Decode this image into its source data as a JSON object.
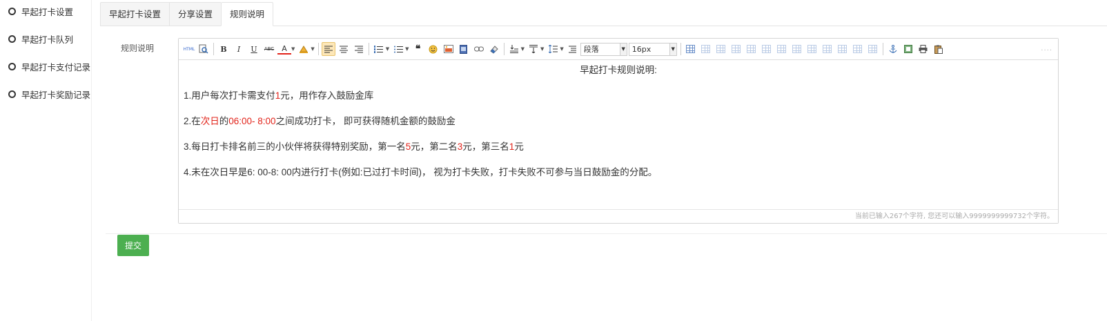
{
  "sidebar": {
    "items": [
      {
        "label": "早起打卡设置"
      },
      {
        "label": "早起打卡队列"
      },
      {
        "label": "早起打卡支付记录"
      },
      {
        "label": "早起打卡奖励记录"
      }
    ]
  },
  "tabs": [
    {
      "label": "早起打卡设置",
      "active": false
    },
    {
      "label": "分享设置",
      "active": false
    },
    {
      "label": "规则说明",
      "active": true
    }
  ],
  "form": {
    "field_label": "规则说明",
    "submit_label": "提交"
  },
  "editor": {
    "toolbar": {
      "html_label": "HTML",
      "bold": "B",
      "italic": "I",
      "underline": "U",
      "strikethrough": "ABC",
      "font_color": "A",
      "paragraph_select": "段落",
      "fontsize_select": "16px",
      "dots": "...."
    },
    "content": {
      "title": "早起打卡规则说明:",
      "rule1": {
        "pre": "1.用户每次打卡需支付",
        "red": "1",
        "post": "元，用作存入鼓励金库"
      },
      "rule2": {
        "pre": "2.在",
        "red1": "次日",
        "mid": "的",
        "red2": "06:00- 8:00",
        "post": "之间成功打卡， 即可获得随机金额的鼓励金"
      },
      "rule3": {
        "pre": "3.每日打卡排名前三的小伙伴将获得特别奖励，第一名",
        "red1": "5",
        "mid1": "元，第二名",
        "red2": "3",
        "mid2": "元，第三名",
        "red3": "1",
        "post": "元"
      },
      "rule4": "4.未在次日早是6: 00-8: 00内进行打卡(例如:已过打卡时间)， 视为打卡失败，打卡失败不可参与当日鼓励金的分配。"
    },
    "wordcount": "当前已输入267个字符, 您还可以输入9999999999732个字符。"
  },
  "colors": {
    "accent_red": "#e2231a",
    "submit_green": "#4caf50"
  }
}
